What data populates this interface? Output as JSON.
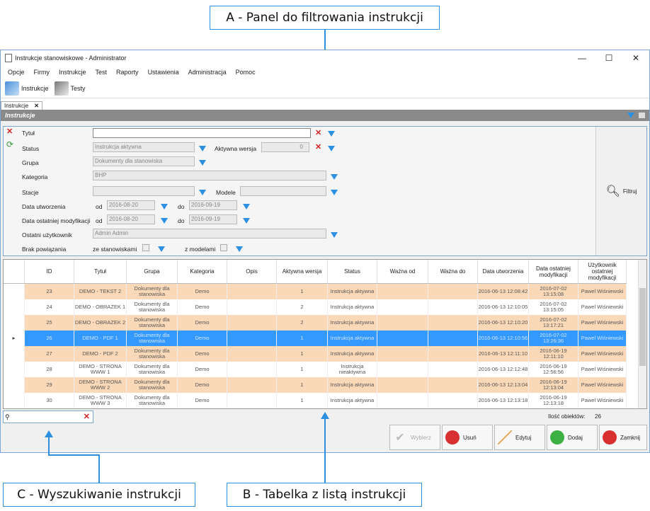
{
  "callouts": {
    "a": "A - Panel do filtrowania instrukcji",
    "b": "B - Tabelka z listą instrukcji",
    "c": "C - Wyszukiwanie instrukcji"
  },
  "window": {
    "title": "Instrukcje stanowiskowe - Administrator",
    "controls": [
      "—",
      "☐",
      "✕"
    ]
  },
  "menu": [
    "Opcje",
    "Firmy",
    "Instrukcje",
    "Test",
    "Raporty",
    "Ustawienia",
    "Administracja",
    "Pomoc"
  ],
  "toolbar": {
    "instrukcje": "Instrukcje",
    "testy": "Testy"
  },
  "tab": {
    "label": "Instrukcje",
    "close": "✕"
  },
  "panel_title": "Instrukcje",
  "filter": {
    "tytul_label": "Tytuł",
    "tytul_value": "",
    "status_label": "Status",
    "status_value": "Instrukcja aktywna",
    "aktywna_wersja_label": "Aktywna wersja",
    "aktywna_wersja_value": "0",
    "grupa_label": "Grupa",
    "grupa_value": "Dokumenty dla stanowiska",
    "kategoria_label": "Kategoria",
    "kategoria_value": "BHP",
    "stacje_label": "Stacje",
    "modele_label": "Modele",
    "data_utw_label": "Data utworzenia",
    "data_mod_label": "Data ostatniej modyfikacji",
    "od": "od",
    "do": "do",
    "utw_od": "2016-08-20",
    "utw_do": "2016-09-19",
    "mod_od": "2016-08-20",
    "mod_do": "2016-09-19",
    "ostatni_label": "Ostatni użytkownik",
    "ostatni_value": "Admin Admin",
    "brak_label": "Brak powiązania",
    "ze_stanowiskami": "ze stanowiskami",
    "z_modelami": "z modelami",
    "filtruj": "Filtruj"
  },
  "grid": {
    "columns": [
      "ID",
      "Tytuł",
      "Grupa",
      "Kategoria",
      "Opis",
      "Aktywna wersja",
      "Status",
      "Ważna od",
      "Ważna do",
      "Data utworzenia",
      "Data ostatniej modyfikacji",
      "Użytkownik ostatniej modyfikacji"
    ],
    "rows": [
      {
        "id": "23",
        "tytul": "DEMO - TEKST 2",
        "grupa": "Dokumenty dla stanowiska",
        "kat": "Demo",
        "opis": "",
        "wersja": "1",
        "status": "Instrukcja aktywna",
        "od": "",
        "do": "",
        "utw": "2016-06-13 12:08:42",
        "mod": "2016-07-02 13:15:08",
        "user": "Pawel Wiśniewski",
        "bg": "#fbd9b8"
      },
      {
        "id": "24",
        "tytul": "DEMO - OBRAZEK 1",
        "grupa": "Dokumenty dla stanowiska",
        "kat": "Demo",
        "opis": "",
        "wersja": "2",
        "status": "Instrukcja aktywna",
        "od": "",
        "do": "",
        "utw": "2016-06-13 12:10:05",
        "mod": "2016-07-02 13:15:05",
        "user": "Pawel Wiśniewski",
        "bg": "#ffffff"
      },
      {
        "id": "25",
        "tytul": "DEMO - OBRAZEK 2",
        "grupa": "Dokumenty dla stanowiska",
        "kat": "Demo",
        "opis": "",
        "wersja": "2",
        "status": "Instrukcja aktywna",
        "od": "",
        "do": "",
        "utw": "2016-06-13 12:10:20",
        "mod": "2016-07-02 13:17:21",
        "user": "Pawel Wiśniewski",
        "bg": "#fbd9b8"
      },
      {
        "id": "26",
        "tytul": "DEMO - PDF 1",
        "grupa": "Dokumenty dla stanowiska",
        "kat": "Demo",
        "opis": "",
        "wersja": "1",
        "status": "Instrukcja aktywna",
        "od": "",
        "do": "",
        "utw": "2016-06-13 12:10:56",
        "mod": "2016-07-02 13:26:36",
        "user": "Pawel Wiśniewski",
        "bg": "#3399ff"
      },
      {
        "id": "27",
        "tytul": "DEMO - PDF 2",
        "grupa": "Dokumenty dla stanowiska",
        "kat": "Demo",
        "opis": "",
        "wersja": "1",
        "status": "Instrukcja aktywna",
        "od": "",
        "do": "",
        "utw": "2016-06-13 12:11:10",
        "mod": "2016-06-19 12:11:10",
        "user": "Pawel Wiśniewski",
        "bg": "#fbd9b8"
      },
      {
        "id": "28",
        "tytul": "DEMO - STRONA WWW 1",
        "grupa": "Dokumenty dla stanowiska",
        "kat": "Demo",
        "opis": "",
        "wersja": "1",
        "status": "Instrukcja nieaktywna",
        "od": "",
        "do": "",
        "utw": "2016-06-13 12:12:48",
        "mod": "2016-06-19 12:56:56",
        "user": "Pawel Wiśniewski",
        "bg": "#ffffff"
      },
      {
        "id": "29",
        "tytul": "DEMO - STRONA WWW 2",
        "grupa": "Dokumenty dla stanowiska",
        "kat": "Demo",
        "opis": "",
        "wersja": "1",
        "status": "Instrukcja aktywna",
        "od": "",
        "do": "",
        "utw": "2016-06-13 12:13:04",
        "mod": "2016-06-19 12:13:04",
        "user": "Pawel Wiśniewski",
        "bg": "#fbd9b8"
      },
      {
        "id": "30",
        "tytul": "DEMO - STRONA WWW 3",
        "grupa": "Dokumenty dla stanowiska",
        "kat": "Demo",
        "opis": "",
        "wersja": "1",
        "status": "Instrukcja aktywna",
        "od": "",
        "do": "",
        "utw": "2016-06-13 12:13:18",
        "mod": "2016-06-19 12:13:18",
        "user": "Pawel Wiśniewski",
        "bg": "#ffffff"
      }
    ]
  },
  "count_label": "Ilość obiektów:",
  "count_value": "26",
  "buttons": {
    "wybierz": "Wybierz",
    "usun": "Usuń",
    "edytuj": "Edytuj",
    "dodaj": "Dodaj",
    "zamknij": "Zamknij"
  },
  "colors": {
    "accent": "#2d8fe0",
    "row_alt": "#fbd9b8",
    "selected": "#3399ff"
  }
}
